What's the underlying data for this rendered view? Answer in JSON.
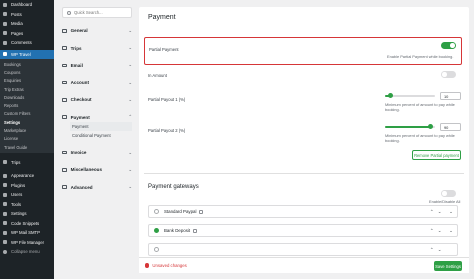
{
  "wp_sidebar": {
    "items_top": [
      {
        "label": "Dashboard",
        "icon": "dashboard-icon"
      },
      {
        "label": "Posts",
        "icon": "pin-icon"
      },
      {
        "label": "Media",
        "icon": "media-icon"
      },
      {
        "label": "Pages",
        "icon": "page-icon"
      },
      {
        "label": "Comments",
        "icon": "comment-icon"
      }
    ],
    "active_item": {
      "label": "WP Travel",
      "icon": "travel-icon"
    },
    "submenu": [
      "Bookings",
      "Coupons",
      "Enquiries",
      "Trip Extras",
      "Downloads",
      "Reports",
      "Custom Filters",
      "Settings",
      "Marketplace",
      "License",
      "Travel Guide"
    ],
    "current_submenu": "Settings",
    "items_bottom": [
      {
        "label": "Trips",
        "icon": "trips-icon"
      },
      {
        "label": "Appearance",
        "icon": "brush-icon"
      },
      {
        "label": "Plugins",
        "icon": "plugin-icon"
      },
      {
        "label": "Users",
        "icon": "users-icon"
      },
      {
        "label": "Tools",
        "icon": "wrench-icon"
      },
      {
        "label": "Settings",
        "icon": "settings-icon"
      },
      {
        "label": "Code Snippets",
        "icon": "code-icon"
      },
      {
        "label": "WP Mail SMTP",
        "icon": "mail-icon"
      },
      {
        "label": "WP File Manager",
        "icon": "folder-icon"
      }
    ],
    "collapse_label": "Collapse menu"
  },
  "settings_nav": {
    "search_placeholder": "Quick Search...",
    "groups": [
      {
        "label": "General",
        "icon": "general-icon",
        "chevron": "⌄"
      },
      {
        "label": "Trips",
        "icon": "trips-icon",
        "chevron": "⌄"
      },
      {
        "label": "Email",
        "icon": "email-icon",
        "chevron": "⌄"
      },
      {
        "label": "Account",
        "icon": "account-icon",
        "chevron": "⌄"
      },
      {
        "label": "Checkout",
        "icon": "checkout-icon",
        "chevron": "⌄"
      },
      {
        "label": "Payment",
        "icon": "payment-icon",
        "chevron": "⌃"
      },
      {
        "label": "Invoice",
        "icon": "invoice-icon",
        "chevron": "⌄"
      },
      {
        "label": "Miscellaneous",
        "icon": "misc-icon",
        "chevron": "⌄"
      },
      {
        "label": "Advanced",
        "icon": "advanced-icon",
        "chevron": "⌄"
      }
    ],
    "payment_sub": [
      "Payment",
      "Conditional Payment"
    ],
    "current_sub": "Payment"
  },
  "main": {
    "title": "Payment",
    "partial_payment": {
      "label": "Partial Payment",
      "enabled": true,
      "description": "Enable Partial Payment while booking."
    },
    "in_amount": {
      "label": "In Amount",
      "enabled": false
    },
    "payout_1": {
      "label": "Partial Payout 1 (%)",
      "value": "10",
      "fill_percent": 10,
      "description": "Minimum percent of amount to pay while booking."
    },
    "payout_2": {
      "label": "Partial Payout 2 (%)",
      "value": "90",
      "fill_percent": 90,
      "description": "Minimum percent of amount to pay while booking."
    },
    "remove_button": "Remove Partial payment",
    "gateways_title": "Payment gateways",
    "gateways_toggle_label": "Enable/Disable All",
    "gateways": [
      {
        "name": "Standard Paypal",
        "status": "empty",
        "arrows": "⌃ ⌄",
        "chevron": "⌄"
      },
      {
        "name": "Bank Deposit",
        "status": "ok",
        "arrows": "⌃ ⌄",
        "chevron": "⌄"
      },
      {
        "name": "",
        "status": "empty",
        "arrows": "⌃ ⌄",
        "chevron": ""
      }
    ]
  },
  "footer": {
    "unsaved": "Unsaved changes",
    "save": "Save Settings"
  },
  "colors": {
    "accent": "#2e9f45",
    "danger": "#d63638",
    "wp_dark": "#1d2327",
    "wp_blue": "#2271b1"
  }
}
